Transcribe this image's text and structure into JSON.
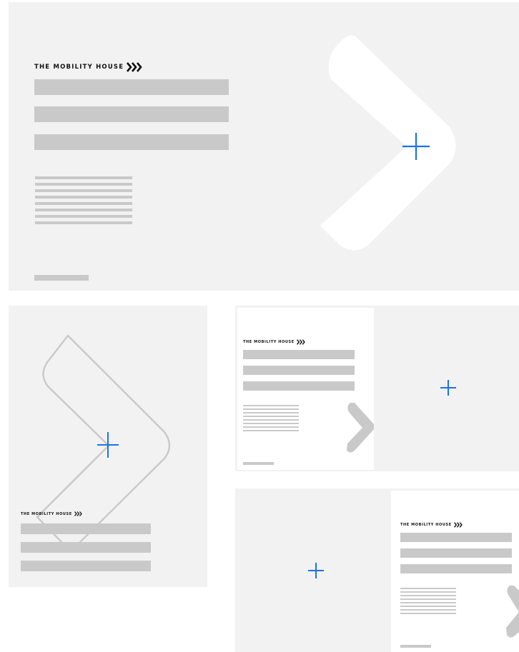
{
  "brand": {
    "name": "THE MOBILITY HOUSE",
    "mark_icon": "triple-chevron-icon"
  },
  "colors": {
    "panel_bg": "#f2f2f2",
    "placeholder": "#c9c9c9",
    "accent_plus": "#1a73e8",
    "chevron_fill": "#ffffff",
    "chevron_outline": "#c9c9c9"
  },
  "layouts": [
    {
      "label": "Wide layout with logo, headline bars, text block and large white chevron with plus mark"
    },
    {
      "label": "Portrait layout with outlined chevron, plus mark and logo with bars at bottom"
    },
    {
      "label": "Split layout: content card left, plus mark right"
    },
    {
      "label": "Split layout: plus mark left, content card right"
    }
  ]
}
